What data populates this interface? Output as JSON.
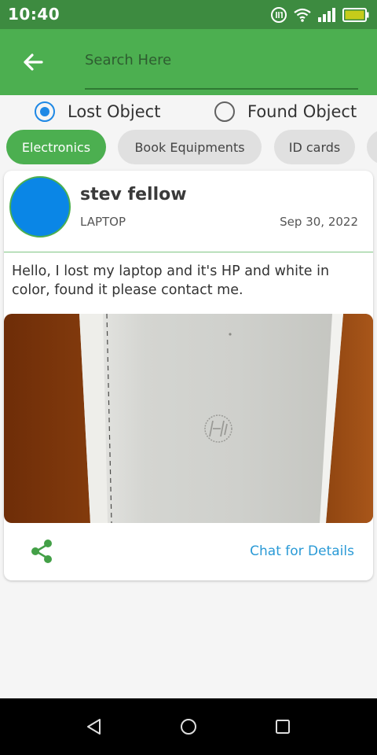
{
  "status_bar": {
    "time": "10:40",
    "icons": [
      "data-saver-icon",
      "wifi-icon",
      "signal-icon",
      "battery-icon"
    ],
    "battery_color": "#c6cc1a"
  },
  "app_bar": {
    "back_icon": "arrow-back-icon",
    "search_placeholder": "Search Here",
    "search_value": "",
    "color": "#4caf50"
  },
  "filter": {
    "options": [
      {
        "label": "Lost Object",
        "selected": true
      },
      {
        "label": "Found Object",
        "selected": false
      }
    ],
    "accent": "#1e88e5"
  },
  "categories": [
    {
      "label": "Electronics",
      "active": true
    },
    {
      "label": "Book Equipments",
      "active": false
    },
    {
      "label": "ID cards",
      "active": false
    },
    {
      "label": "",
      "active": false
    }
  ],
  "post": {
    "user_name": "stev fellow",
    "category": "LAPTOP",
    "date": "Sep 30, 2022",
    "text": "Hello, I lost my laptop and it's HP and white in color, found it please contact me.",
    "share_icon": "share-icon",
    "chat_label": "Chat for Details",
    "avatar_color": "#0a86e6",
    "link_color": "#2a9ad6"
  },
  "nav": {
    "buttons": [
      "back-triangle-icon",
      "home-circle-icon",
      "recents-square-icon"
    ]
  }
}
